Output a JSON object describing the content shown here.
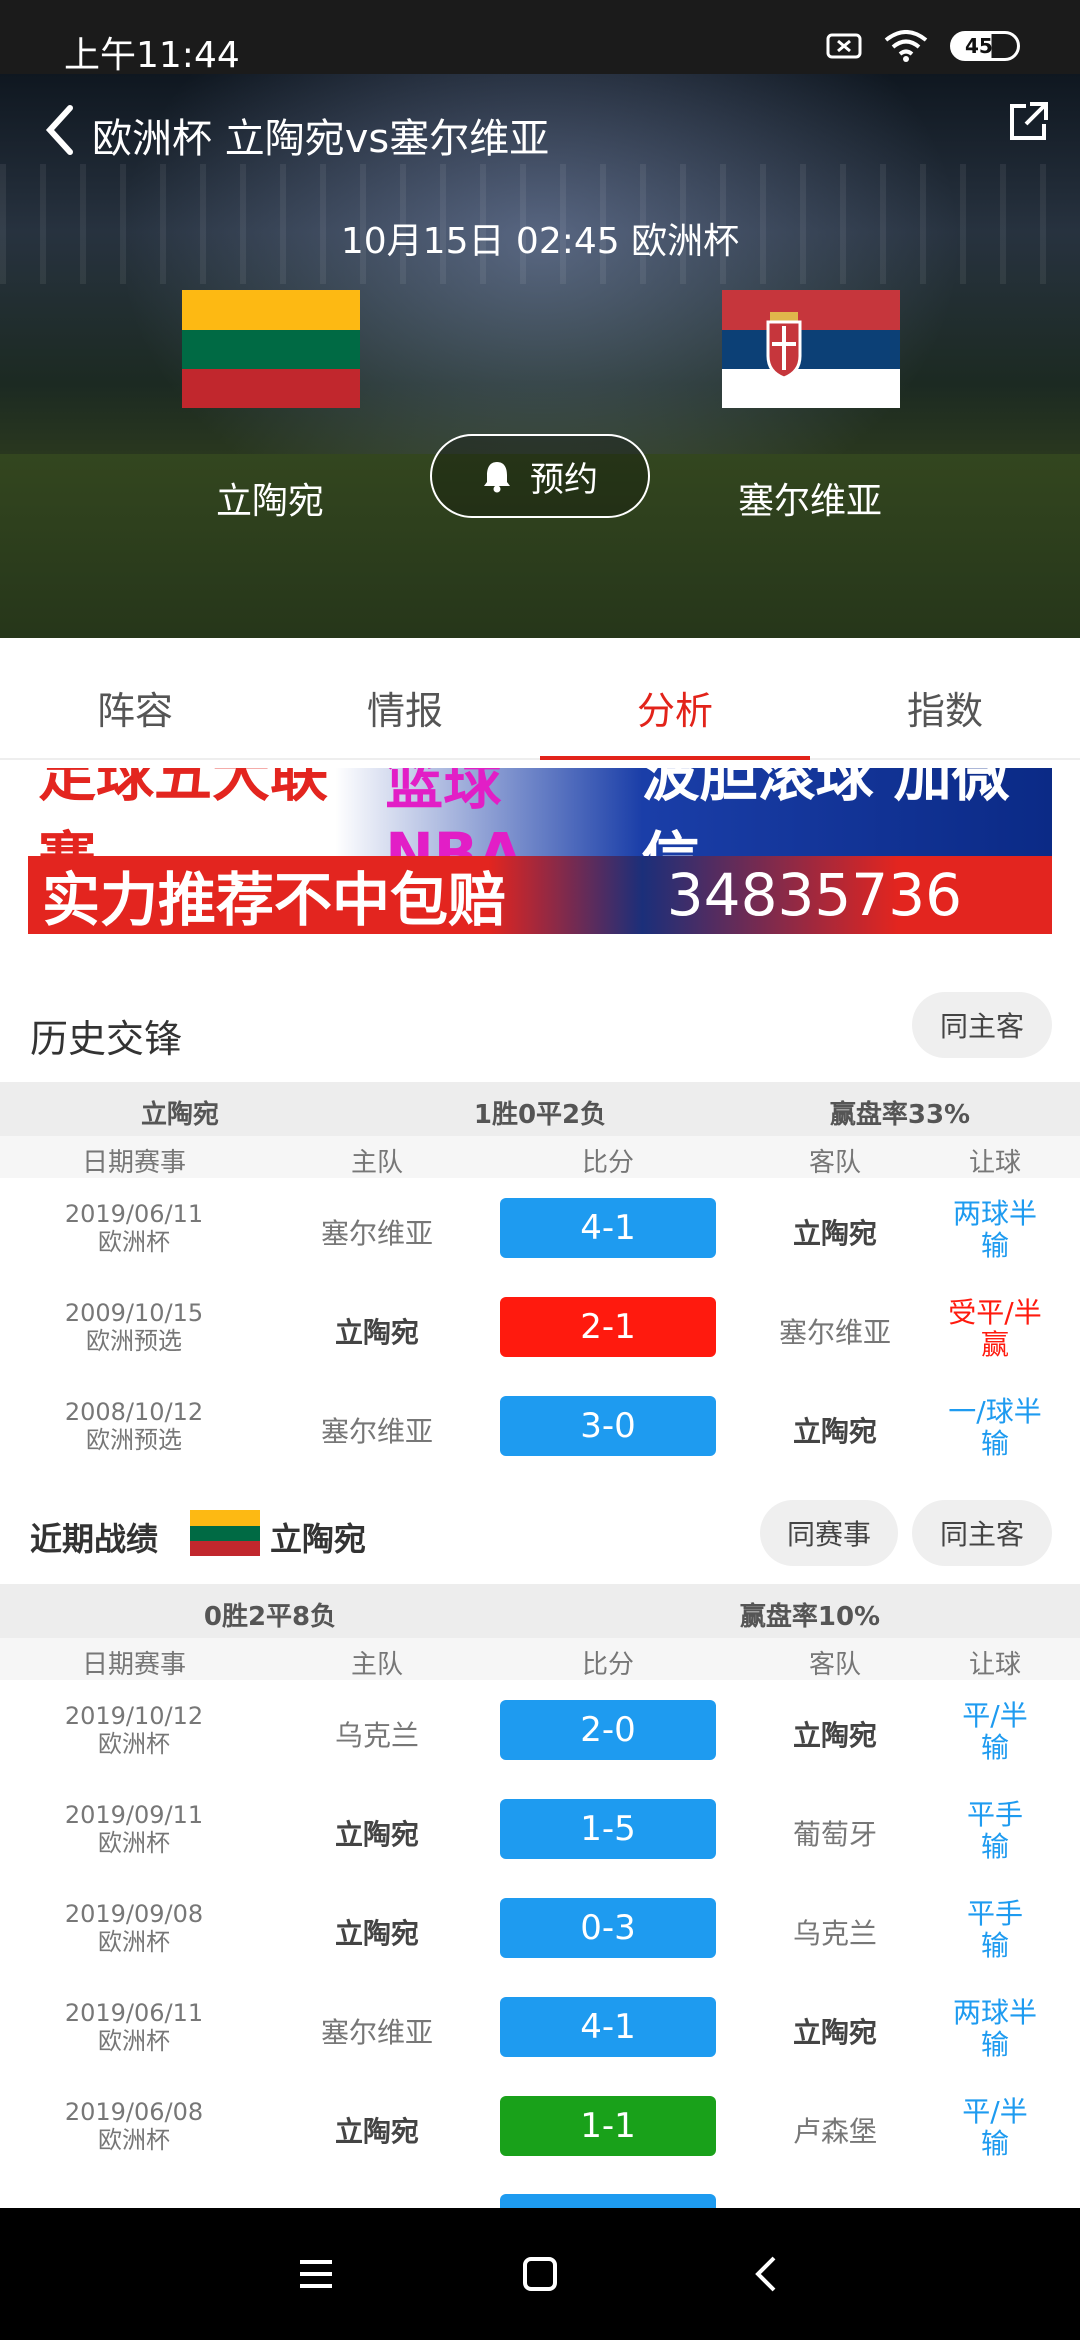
{
  "status_bar": {
    "time": "上午11:44",
    "battery": "45"
  },
  "header": {
    "title": "欧洲杯 立陶宛vs塞尔维亚"
  },
  "match": {
    "datetime": "10月15日 02:45 欧洲杯",
    "home_team": "立陶宛",
    "away_team": "塞尔维亚",
    "reserve_label": "预约"
  },
  "tabs": [
    {
      "label": "阵容"
    },
    {
      "label": "情报"
    },
    {
      "label": "分析"
    },
    {
      "label": "指数"
    }
  ],
  "active_tab": "分析",
  "banner": {
    "line1_a": "足球五大联赛",
    "line1_b": "篮球NBA",
    "line1_c": "波胆滚球 加微信",
    "line2": "实力推荐不中包赔",
    "number": "34835736"
  },
  "h2h": {
    "title": "历史交锋",
    "filter": "同主客",
    "summary": {
      "team": "立陶宛",
      "record": "1胜0平2负",
      "rate": "赢盘率33%"
    },
    "columns": [
      "日期赛事",
      "主队",
      "比分",
      "客队",
      "让球"
    ],
    "rows": [
      {
        "date": "2019/06/11",
        "comp": "欧洲杯",
        "home": "塞尔维亚",
        "score": "4-1",
        "away": "立陶宛",
        "hc1": "两球半",
        "hc2": "输",
        "color": "blue",
        "strong": "away",
        "hc_color": "b"
      },
      {
        "date": "2009/10/15",
        "comp": "欧洲预选",
        "home": "立陶宛",
        "score": "2-1",
        "away": "塞尔维亚",
        "hc1": "受平/半",
        "hc2": "赢",
        "color": "red",
        "strong": "home",
        "hc_color": "r"
      },
      {
        "date": "2008/10/12",
        "comp": "欧洲预选",
        "home": "塞尔维亚",
        "score": "3-0",
        "away": "立陶宛",
        "hc1": "一/球半",
        "hc2": "输",
        "color": "blue",
        "strong": "away",
        "hc_color": "b"
      }
    ]
  },
  "recent": {
    "title": "近期战绩",
    "team": "立陶宛",
    "filter1": "同赛事",
    "filter2": "同主客",
    "summary": {
      "record": "0胜2平8负",
      "rate": "赢盘率10%"
    },
    "columns": [
      "日期赛事",
      "主队",
      "比分",
      "客队",
      "让球"
    ],
    "rows": [
      {
        "date": "2019/10/12",
        "comp": "欧洲杯",
        "home": "乌克兰",
        "score": "2-0",
        "away": "立陶宛",
        "hc1": "平/半",
        "hc2": "输",
        "color": "blue",
        "strong": "away"
      },
      {
        "date": "2019/09/11",
        "comp": "欧洲杯",
        "home": "立陶宛",
        "score": "1-5",
        "away": "葡萄牙",
        "hc1": "平手",
        "hc2": "输",
        "color": "blue",
        "strong": "home"
      },
      {
        "date": "2019/09/08",
        "comp": "欧洲杯",
        "home": "立陶宛",
        "score": "0-3",
        "away": "乌克兰",
        "hc1": "平手",
        "hc2": "输",
        "color": "blue",
        "strong": "home"
      },
      {
        "date": "2019/06/11",
        "comp": "欧洲杯",
        "home": "塞尔维亚",
        "score": "4-1",
        "away": "立陶宛",
        "hc1": "两球半",
        "hc2": "输",
        "color": "blue",
        "strong": "away"
      },
      {
        "date": "2019/06/08",
        "comp": "欧洲杯",
        "home": "立陶宛",
        "score": "1-1",
        "away": "卢森堡",
        "hc1": "平/半",
        "hc2": "输",
        "color": "green",
        "strong": "home"
      }
    ]
  },
  "colors": {
    "accent": "#e2231a",
    "win": "#ff1a0e",
    "loss": "#1e9bf0",
    "draw": "#19a11a"
  }
}
